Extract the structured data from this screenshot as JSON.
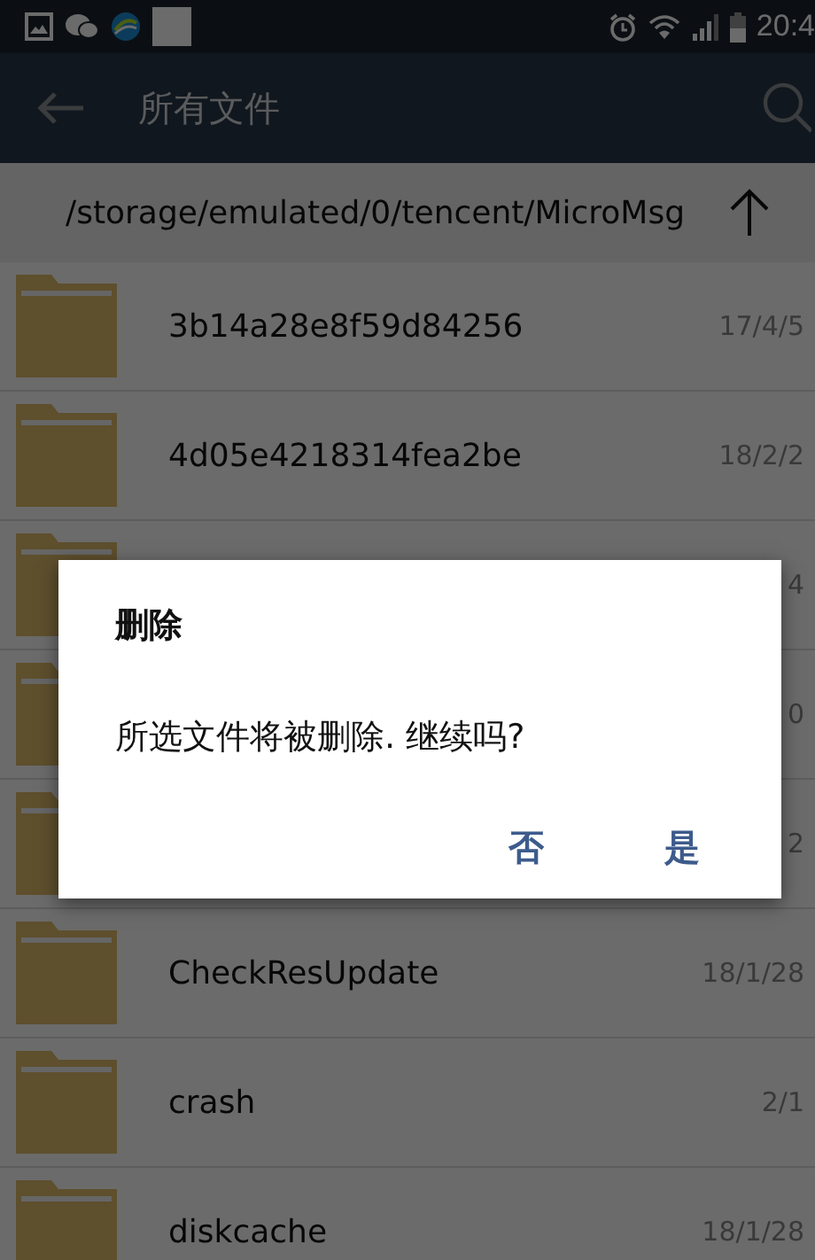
{
  "status_bar": {
    "time": "20:4"
  },
  "toolbar": {
    "title": "所有文件"
  },
  "path_bar": {
    "path": "/storage/emulated/0/tencent/MicroMsg"
  },
  "files": [
    {
      "name": "3b14a28e8f59d84256",
      "date": "17/4/5"
    },
    {
      "name": "4d05e4218314fea2be",
      "date": "18/2/2"
    },
    {
      "date": "4"
    },
    {
      "date": "0"
    },
    {
      "date": "2"
    },
    {
      "name": "CheckResUpdate",
      "date": "18/1/28"
    },
    {
      "name": "crash",
      "date": "2/1"
    },
    {
      "name": "diskcache",
      "date": "18/1/28"
    }
  ],
  "dialog": {
    "title": "删除",
    "message": "所选文件将被删除. 继续吗?",
    "buttons": [
      "否",
      "是"
    ]
  }
}
